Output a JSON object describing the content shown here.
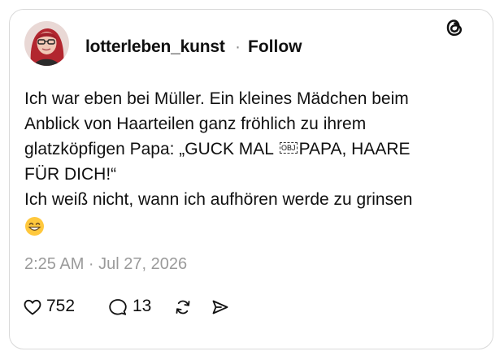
{
  "post": {
    "username": "lotterleben_kunst",
    "separator": "·",
    "follow_label": "Follow",
    "text_line_1": "Ich war eben bei Müller. Ein kleines Mädchen beim",
    "text_line_2": "Anblick von Haarteilen ganz fröhlich zu ihrem",
    "text_line_3a": "glatzköpfigen Papa: „GUCK MAL ",
    "text_obj": "OBJ",
    "text_line_3b": "PAPA, HAARE",
    "text_line_4": "FÜR DICH!“",
    "text_line_5": "Ich weiß nicht, wann ich aufhören werde zu grinsen",
    "emoji": "grinning-face-smiling-eyes",
    "timestamp": "2:25 AM · Jul 27, 2026"
  },
  "actions": {
    "likes": "752",
    "replies": "13"
  },
  "icons": {
    "brand": "threads-logo-icon",
    "like": "heart-icon",
    "reply": "comment-icon",
    "repost": "repost-icon",
    "share": "send-icon"
  },
  "colors": {
    "text": "#101010",
    "muted": "#9a9a9a",
    "border": "#d9d9d9",
    "emoji_yellow": "#ffc83d"
  }
}
